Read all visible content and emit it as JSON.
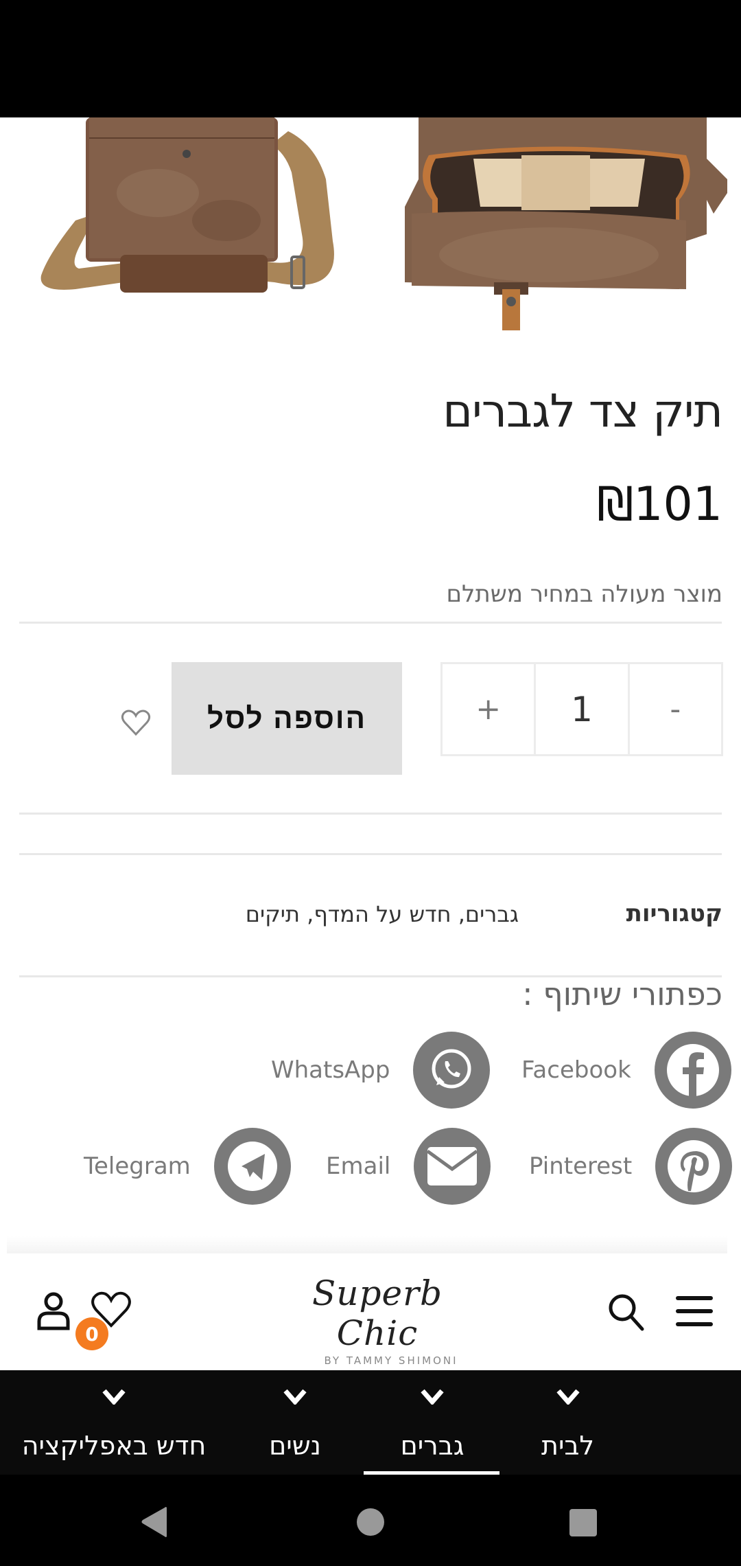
{
  "product": {
    "title": "תיק צד לגברים",
    "price": "₪101",
    "price_note": "מוצר מעולה במחיר משתלם",
    "images": [
      "bag-back-with-strap",
      "bag-open-interior"
    ]
  },
  "purchase": {
    "quantity": "1",
    "increase_label": "+",
    "decrease_label": "-",
    "add_to_cart_label": "הוספה לסל"
  },
  "meta": {
    "categories_label": "קטגוריות",
    "categories_value": "גברים, חדש על המדף, תיקים"
  },
  "share": {
    "title": "כפתורי שיתוף :",
    "buttons": [
      {
        "label": "Facebook",
        "icon": "facebook-icon"
      },
      {
        "label": "WhatsApp",
        "icon": "whatsapp-icon"
      },
      {
        "label": "Pinterest",
        "icon": "pinterest-icon"
      },
      {
        "label": "Email",
        "icon": "email-icon"
      },
      {
        "label": "Telegram",
        "icon": "telegram-icon"
      }
    ]
  },
  "header": {
    "logo_script": "Superb Chic",
    "logo_sub": "BY TAMMY SHIMONI",
    "wishlist_count": "0",
    "badge_color": "#f47b20"
  },
  "nav": {
    "items": [
      {
        "label": "לבית",
        "active": false
      },
      {
        "label": "גברים",
        "active": true
      },
      {
        "label": "נשים",
        "active": false
      },
      {
        "label": "חדש באפליקציה",
        "active": false
      }
    ]
  }
}
